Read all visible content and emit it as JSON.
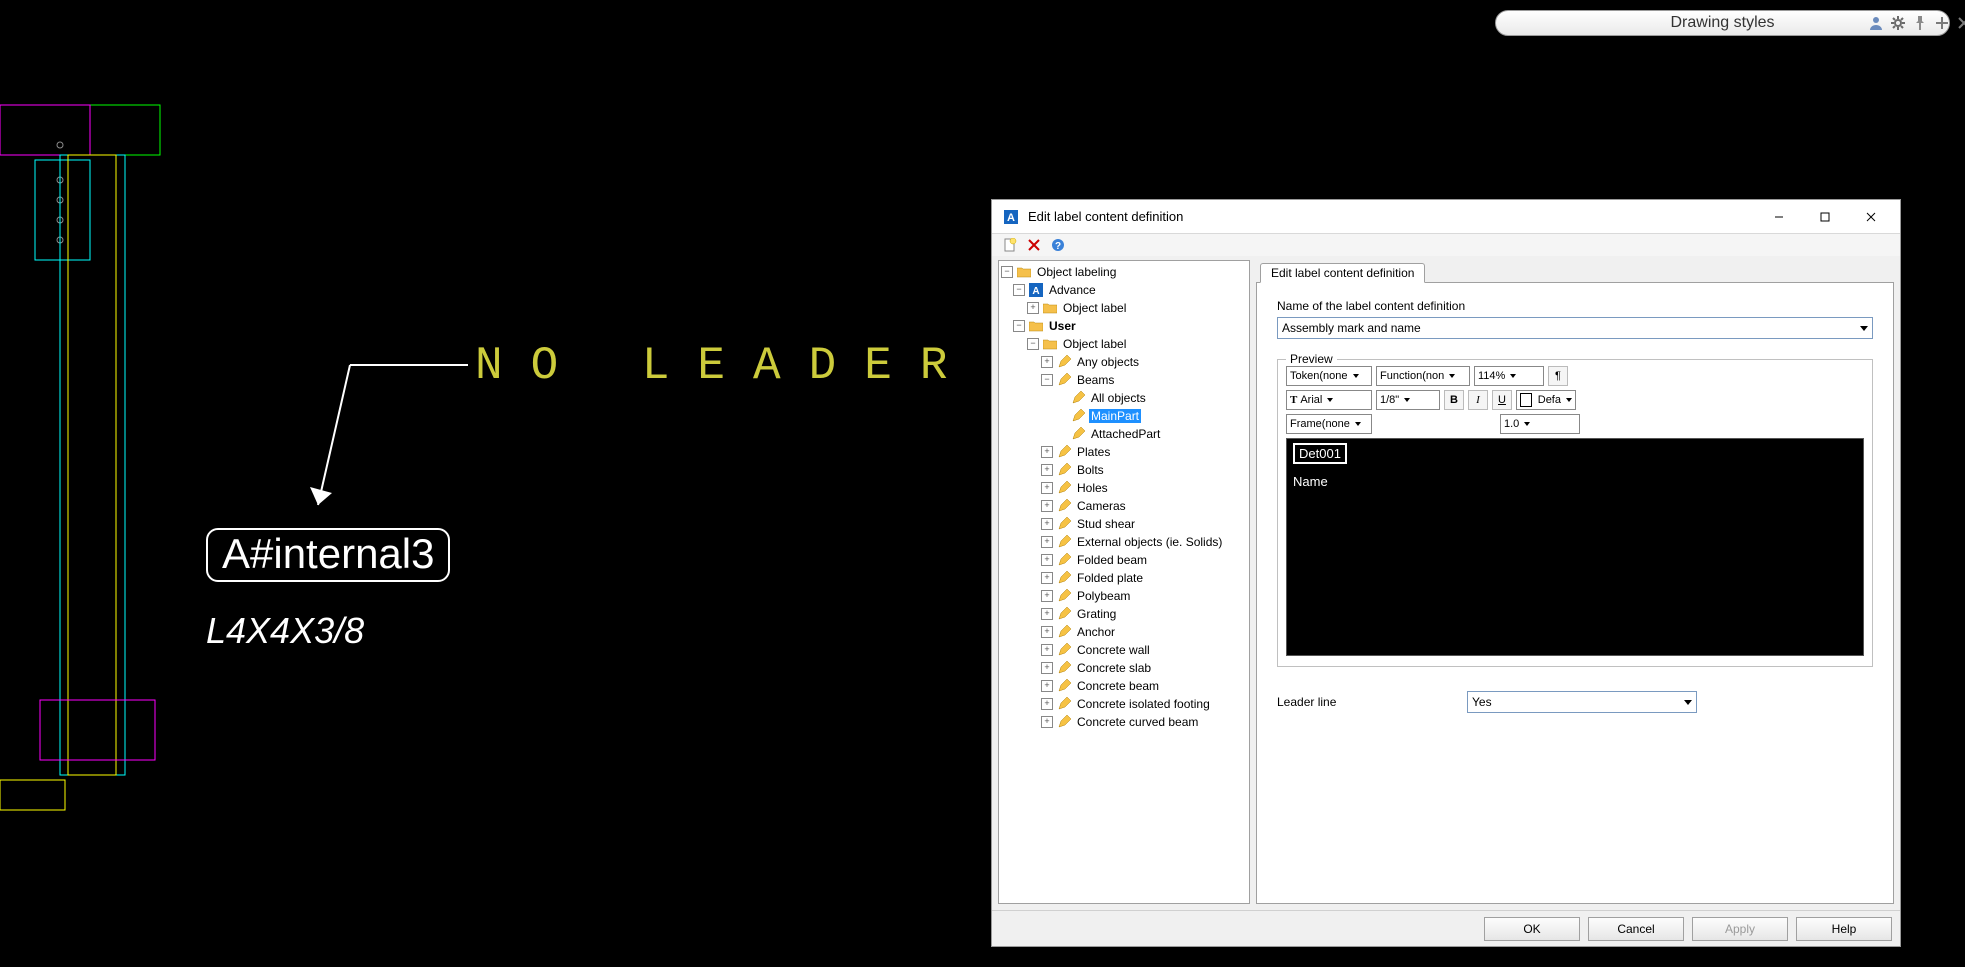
{
  "drawing_styles_pill": "Drawing styles",
  "canvas_annotation": {
    "no_leader_text": "NO LEADER",
    "label_main": "A#internal3",
    "label_sub": "L4X4X3/8"
  },
  "dialog": {
    "title": "Edit label content definition",
    "tab_label": "Edit label content definition",
    "name_field_label": "Name of the label content definition",
    "name_field_value": "Assembly mark and name",
    "preview_legend": "Preview",
    "toolbar": {
      "token": "Token(none",
      "function": "Function(non",
      "zoom": "114%",
      "pilcrow": "¶",
      "font": "Arial",
      "size": "1/8\"",
      "bold": "B",
      "italic": "I",
      "underline": "U",
      "color_name": "Defa",
      "frame": "Frame(none",
      "linew": "1.0"
    },
    "preview_canvas": {
      "chip": "Det001",
      "name": "Name"
    },
    "leader_label": "Leader line",
    "leader_value": "Yes",
    "buttons": {
      "ok": "OK",
      "cancel": "Cancel",
      "apply": "Apply",
      "help": "Help"
    }
  },
  "tree": {
    "root": "Object labeling",
    "advance": "Advance",
    "advance_objectlabel": "Object label",
    "user": "User",
    "user_objectlabel": "Object label",
    "user_anyobjects": "Any objects",
    "user_beams": "Beams",
    "user_beams_all": "All objects",
    "user_beams_main": "MainPart",
    "user_beams_attached": "AttachedPart",
    "items": [
      "Plates",
      "Bolts",
      "Holes",
      "Cameras",
      "Stud shear",
      "External objects (ie. Solids)",
      "Folded beam",
      "Folded plate",
      "Polybeam",
      "Grating",
      "Anchor",
      "Concrete wall",
      "Concrete slab",
      "Concrete beam",
      "Concrete isolated footing",
      "Concrete curved beam"
    ]
  }
}
